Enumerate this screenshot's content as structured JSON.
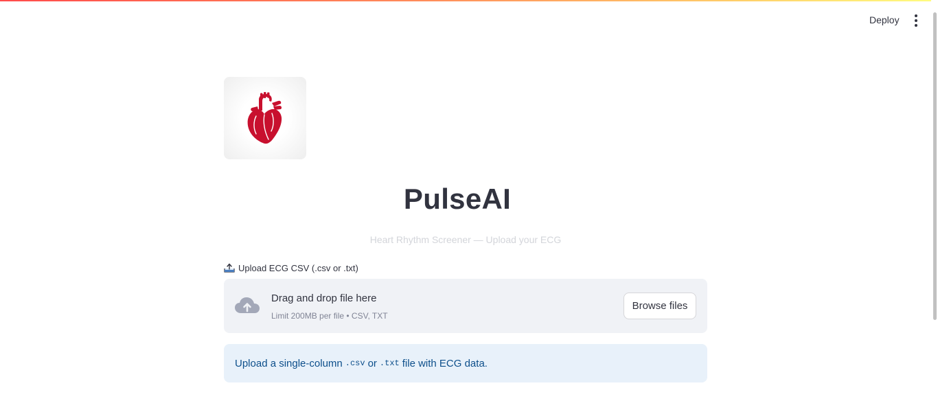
{
  "header": {
    "deploy_label": "Deploy",
    "menu_icon": "kebab-menu-icon"
  },
  "logo": {
    "icon": "heart-icon",
    "heart_color": "#c8102e"
  },
  "page": {
    "title": "PulseAI",
    "subtitle": "Heart Rhythm Screener — Upload your ECG"
  },
  "uploader": {
    "label_icon": "upload-tray-icon",
    "label": "Upload ECG CSV (.csv or .txt)",
    "drop_icon": "cloud-upload-icon",
    "drop_title": "Drag and drop file here",
    "drop_limit": "Limit 200MB per file • CSV, TXT",
    "browse_label": "Browse files"
  },
  "info": {
    "text_before": "Upload a single-column",
    "code_csv": ".csv",
    "text_or": "or",
    "code_txt": ".txt",
    "text_after": "file with ECG data."
  },
  "colors": {
    "accent_gradient_start": "#ff4b4b",
    "accent_gradient_end": "#fffd80",
    "dropzone_bg": "#f0f2f6",
    "info_bg": "#e8f1fa",
    "info_text": "#0d4f8b"
  }
}
